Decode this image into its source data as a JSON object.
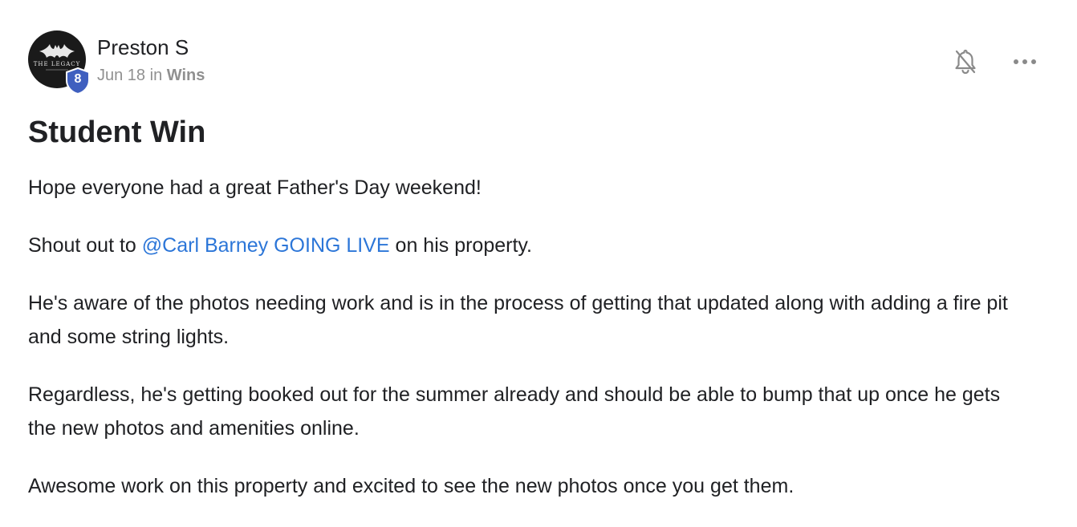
{
  "post": {
    "author": "Preston S",
    "level": "8",
    "date": "Jun 18",
    "in_label": "in",
    "category": "Wins",
    "title": "Student Win",
    "avatar_text": "THE LEGACY",
    "paragraphs": [
      "Hope everyone had a great Father's Day weekend!",
      {
        "before": "Shout out to ",
        "mention": "@Carl Barney GOING LIVE",
        "after": " on his property."
      },
      "He's aware of the photos needing work and is in the process of getting that updated along with adding a fire pit and some string lights.",
      "Regardless, he's getting booked out for the summer already and should be able to bump that up once he gets the new photos and amenities online.",
      "Awesome work on this property and excited to see the new photos once you get them."
    ]
  },
  "actions": {
    "notify_icon": "bell-off-icon",
    "more_icon": "more-horizontal-icon"
  },
  "colors": {
    "mention": "#2c76d8",
    "level_badge": "#3f5fbf",
    "muted_text": "#909090",
    "avatar_bg": "#1a1a1a"
  }
}
